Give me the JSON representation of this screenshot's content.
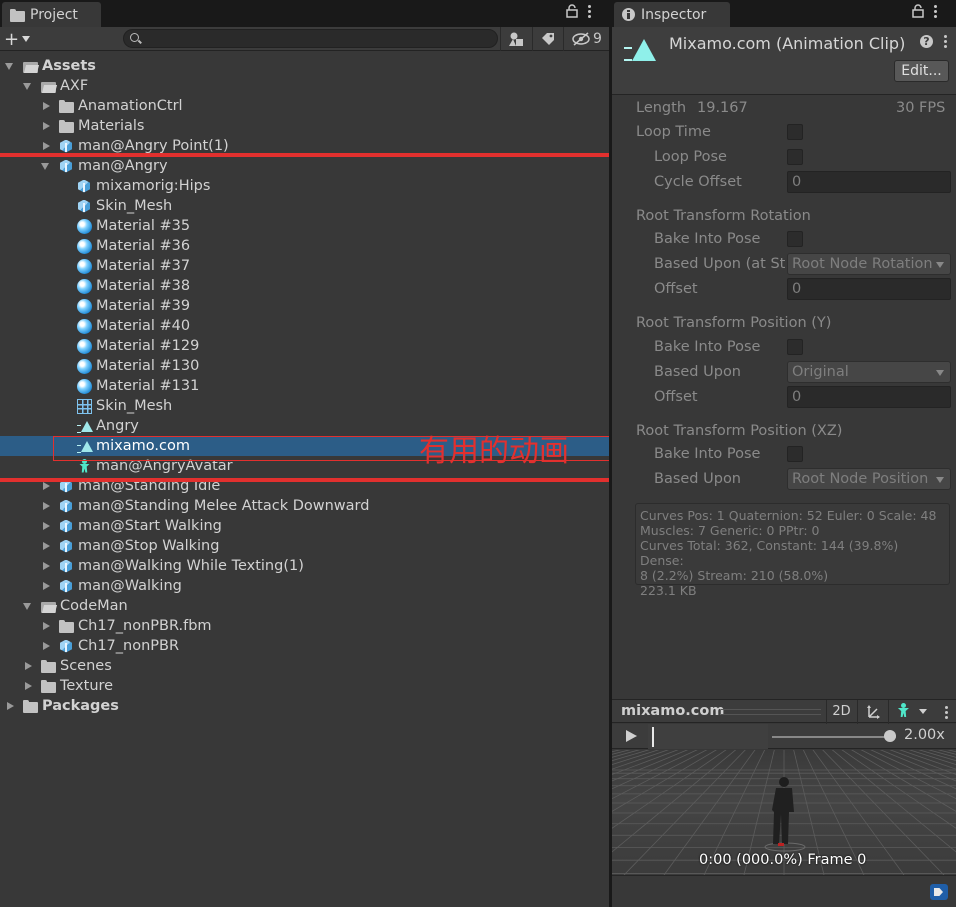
{
  "project": {
    "tab_label": "Project",
    "search": {
      "value": "",
      "placeholder": ""
    },
    "hidden_count": "9",
    "tree": [
      {
        "label": "Assets",
        "depth": 0,
        "icon": "folder-open",
        "arrow": "down",
        "bold": true
      },
      {
        "label": "AXF",
        "depth": 1,
        "icon": "folder-open",
        "arrow": "down"
      },
      {
        "label": "AnamationCtrl",
        "depth": 2,
        "icon": "folder",
        "arrow": "right"
      },
      {
        "label": "Materials",
        "depth": 2,
        "icon": "folder",
        "arrow": "right"
      },
      {
        "label": "man@Angry Point(1)",
        "depth": 2,
        "icon": "model",
        "arrow": "right"
      },
      {
        "label": "man@Angry",
        "depth": 2,
        "icon": "model",
        "arrow": "down"
      },
      {
        "label": "mixamorig:Hips",
        "depth": 3,
        "icon": "model",
        "arrow": "none"
      },
      {
        "label": "Skin_Mesh",
        "depth": 3,
        "icon": "model",
        "arrow": "none"
      },
      {
        "label": "Material #35",
        "depth": 3,
        "icon": "material",
        "arrow": "none"
      },
      {
        "label": "Material #36",
        "depth": 3,
        "icon": "material",
        "arrow": "none"
      },
      {
        "label": "Material #37",
        "depth": 3,
        "icon": "material",
        "arrow": "none"
      },
      {
        "label": "Material #38",
        "depth": 3,
        "icon": "material",
        "arrow": "none"
      },
      {
        "label": "Material #39",
        "depth": 3,
        "icon": "material",
        "arrow": "none"
      },
      {
        "label": "Material #40",
        "depth": 3,
        "icon": "material",
        "arrow": "none"
      },
      {
        "label": "Material #129",
        "depth": 3,
        "icon": "material",
        "arrow": "none"
      },
      {
        "label": "Material #130",
        "depth": 3,
        "icon": "material",
        "arrow": "none"
      },
      {
        "label": "Material #131",
        "depth": 3,
        "icon": "material",
        "arrow": "none"
      },
      {
        "label": "Skin_Mesh",
        "depth": 3,
        "icon": "mesh",
        "arrow": "none"
      },
      {
        "label": "Angry",
        "depth": 3,
        "icon": "anim",
        "arrow": "none"
      },
      {
        "label": "mixamo.com",
        "depth": 3,
        "icon": "anim",
        "arrow": "none",
        "selected": true
      },
      {
        "label": "man@AngryAvatar",
        "depth": 3,
        "icon": "avatar",
        "arrow": "none"
      },
      {
        "label": "man@Standing Idle",
        "depth": 2,
        "icon": "model",
        "arrow": "right"
      },
      {
        "label": "man@Standing Melee Attack Downward",
        "depth": 2,
        "icon": "model",
        "arrow": "right"
      },
      {
        "label": "man@Start Walking",
        "depth": 2,
        "icon": "model",
        "arrow": "right"
      },
      {
        "label": "man@Stop Walking",
        "depth": 2,
        "icon": "model",
        "arrow": "right"
      },
      {
        "label": "man@Walking While Texting(1)",
        "depth": 2,
        "icon": "model",
        "arrow": "right"
      },
      {
        "label": "man@Walking",
        "depth": 2,
        "icon": "model",
        "arrow": "right"
      },
      {
        "label": "CodeMan",
        "depth": 1,
        "icon": "folder-open",
        "arrow": "down"
      },
      {
        "label": "Ch17_nonPBR.fbm",
        "depth": 2,
        "icon": "folder",
        "arrow": "right"
      },
      {
        "label": "Ch17_nonPBR",
        "depth": 2,
        "icon": "model",
        "arrow": "right"
      },
      {
        "label": "Scenes",
        "depth": 1,
        "icon": "folder",
        "arrow": "right"
      },
      {
        "label": "Texture",
        "depth": 1,
        "icon": "folder",
        "arrow": "right"
      },
      {
        "label": "Packages",
        "depth": 0,
        "icon": "folder",
        "arrow": "right",
        "bold": true
      }
    ]
  },
  "annotation": {
    "text": "有用的动画",
    "color": "#e2302e"
  },
  "inspector": {
    "tab_label": "Inspector",
    "title": "Mixamo.com (Animation Clip)",
    "edit_label": "Edit...",
    "length_label": "Length",
    "length_value": "19.167",
    "fps": "30 FPS",
    "loop_time": "Loop Time",
    "loop_pose": "Loop Pose",
    "cycle_offset": "Cycle Offset",
    "cycle_offset_value": "0",
    "rtr_header": "Root Transform Rotation",
    "rtr_bake": "Bake Into Pose",
    "rtr_based": "Based Upon (at St",
    "rtr_based_value": "Root Node Rotation",
    "rtr_offset": "Offset",
    "rtr_offset_value": "0",
    "rty_header": "Root Transform Position (Y)",
    "rty_bake": "Bake Into Pose",
    "rty_based": "Based Upon",
    "rty_based_value": "Original",
    "rty_offset": "Offset",
    "rty_offset_value": "0",
    "rtxz_header": "Root Transform Position (XZ)",
    "rtxz_bake": "Bake Into Pose",
    "rtxz_based": "Based Upon",
    "rtxz_based_value": "Root Node Position",
    "stats": [
      "Curves Pos: 1 Quaternion: 52 Euler: 0 Scale: 48",
      "Muscles: 7 Generic: 0 PPtr: 0",
      "Curves Total: 362, Constant: 144 (39.8%) Dense:",
      "8 (2.2%) Stream: 210 (58.0%)",
      "223.1 KB"
    ],
    "preview": {
      "name": "mixamo.com",
      "btn_2d": "2D",
      "speed": "2.00x",
      "speed_fraction": 0.95,
      "frame_text": "0:00 (000.0%) Frame 0"
    }
  },
  "colors": {
    "selection": "#2c5d87",
    "annotation": "#e2302e",
    "background": "#383838"
  }
}
